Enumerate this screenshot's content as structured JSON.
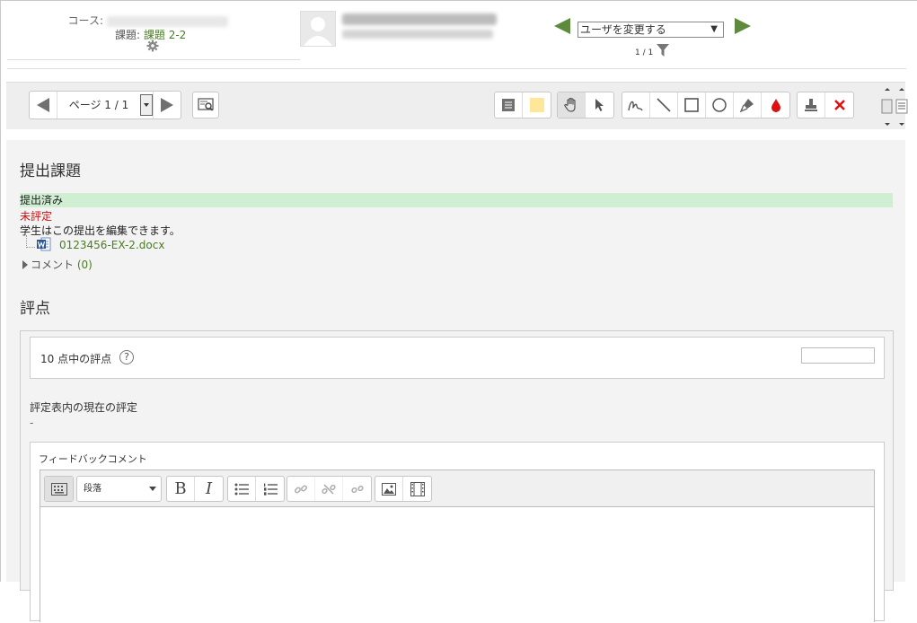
{
  "header": {
    "course_label": "コース:",
    "assignment_label": "課題:",
    "assignment_value": "課題 2-2",
    "user_select": "ユーザを変更する",
    "user_count": "1 / 1"
  },
  "toolbar": {
    "page_label": "ページ 1 / 1"
  },
  "submission": {
    "heading": "提出課題",
    "status": "提出済み",
    "grading_status": "未評定",
    "edit_note": "学生はこの提出を編集できます。",
    "file_name": "0123456-EX-2.docx",
    "comments_label": "コメント",
    "comments_count": "(0)"
  },
  "grade": {
    "heading": "評点",
    "grade_label": "10 点中の評点",
    "help_glyph": "?",
    "current_label": "評定表内の現在の評定",
    "current_value": "-",
    "feedback_label": "フィードバックコメント",
    "format_select": "段落",
    "bold": "B",
    "italic": "I"
  },
  "colors": {
    "accent_green": "#4a7c22",
    "nav_arrow": "#5e8a3e",
    "status_bg": "#cfeed2",
    "error_red": "#cc1111"
  }
}
